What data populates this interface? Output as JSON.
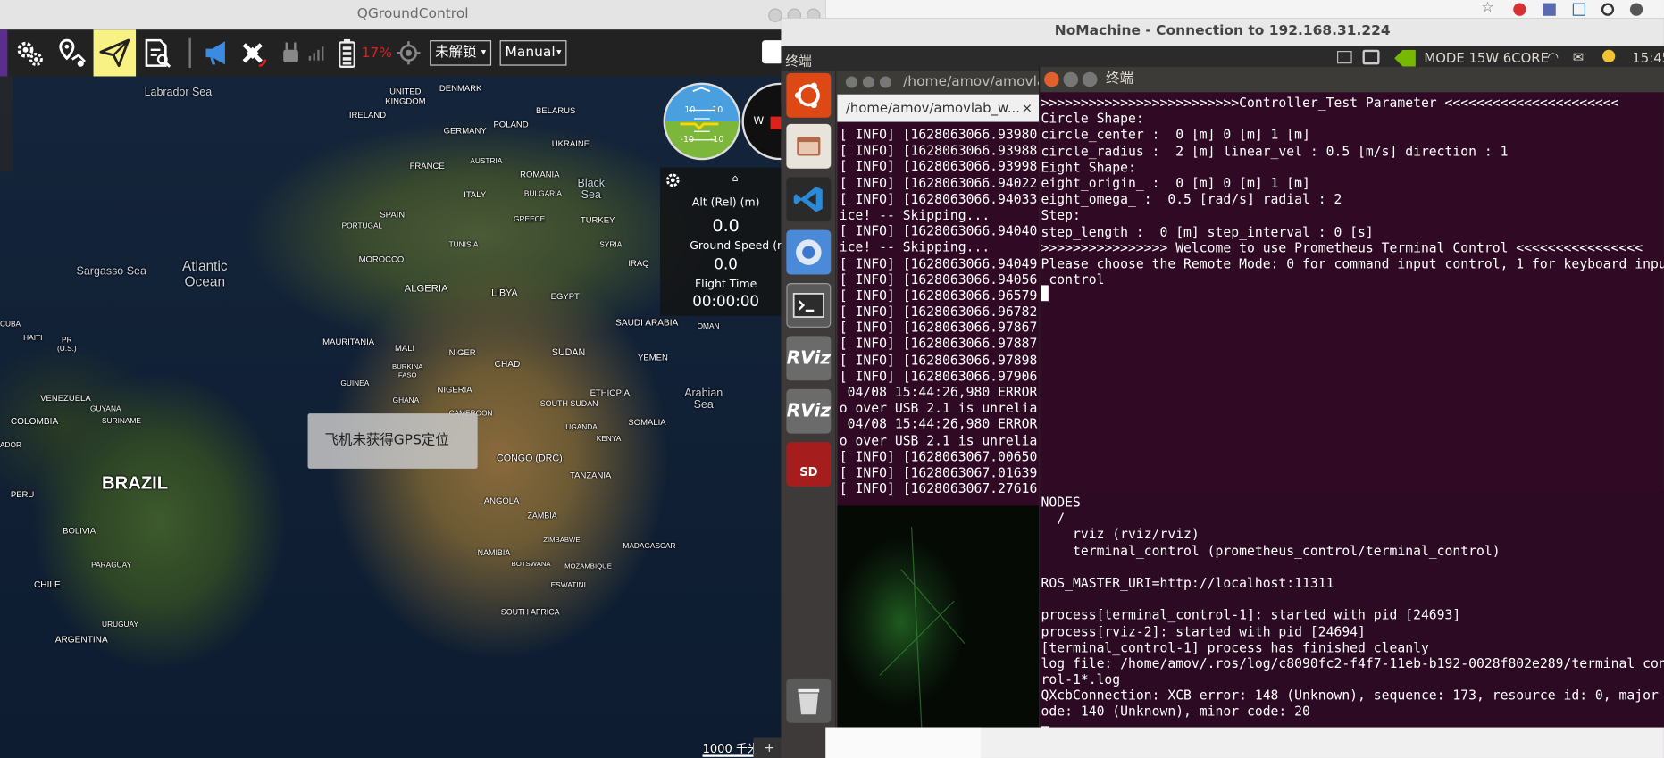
{
  "qgc": {
    "title": "QGroundControl",
    "toolbar": {
      "battery_pct": "17%",
      "arm_label": "未解锁",
      "mode_label": "Manual"
    },
    "map": {
      "labels": {
        "labrador_sea": "Labrador Sea",
        "denmark": "DENMARK",
        "united_kingdom": "UNITED KINGDOM",
        "ireland": "IRELAND",
        "belarus": "BELARUS",
        "poland": "POLAND",
        "germany": "GERMANY",
        "ukraine": "UKRAINE",
        "france": "FRANCE",
        "austria": "AUSTRIA",
        "romania": "ROMANIA",
        "italy": "ITALY",
        "bulgaria": "BULGARIA",
        "black_sea": "Black Sea",
        "spain": "SPAIN",
        "portugal": "PORTUGAL",
        "greece": "GREECE",
        "turkey": "TURKEY",
        "tunisia": "TUNISIA",
        "syria": "SYRIA",
        "iraq": "IRAQ",
        "morocco": "MOROCCO",
        "sargasso_sea": "Sargasso Sea",
        "atlantic_ocean": "Atlantic Ocean",
        "algeria": "ALGERIA",
        "libya": "LIBYA",
        "egypt": "EGYPT",
        "saudi_arabia": "SAUDI ARABIA",
        "oman": "OMAN",
        "cuba": "CUBA",
        "haiti": "HAITI",
        "pr": "PR (U.S.)",
        "mauritania": "MAURITANIA",
        "mali": "MALI",
        "niger": "NIGER",
        "chad": "CHAD",
        "sudan": "SUDAN",
        "yemen": "YEMEN",
        "burkina_faso": "BURKINA FASO",
        "guinea": "GUINEA",
        "nigeria": "NIGERIA",
        "ethiopia": "ETHIOPIA",
        "arabian_sea": "Arabian Sea",
        "venezuela": "VENEZUELA",
        "guyana": "GUYANA",
        "suriname": "SURINAME",
        "ghana": "GHANA",
        "cameroon": "CAMEROON",
        "south_sudan": "SOUTH SUDAN",
        "somalia": "SOMALIA",
        "colombia": "COLOMBIA",
        "uganda": "UGANDA",
        "kenya": "KENYA",
        "ador": "ADOR",
        "congo": "CONGO (DRC)",
        "brazil": "BRAZIL",
        "tanzania": "TANZANIA",
        "peru": "PERU",
        "angola": "ANGOLA",
        "zambia": "ZAMBIA",
        "bolivia": "BOLIVIA",
        "zimbabwe": "ZIMBABWE",
        "madagascar": "MADAGASCAR",
        "paraguay": "PARAGUAY",
        "namibia": "NAMIBIA",
        "botswana": "BOTSWANA",
        "mozambique": "MOZAMBIQUE",
        "chile": "CHILE",
        "eswatini": "ESWATINI",
        "south_africa": "SOUTH AFRICA",
        "uruguay": "URUGUAY",
        "argentina": "ARGENTINA"
      },
      "gps_toast": "飞机未获得GPS定位",
      "scale_label": "1000 千米"
    },
    "attitude": {
      "pitch_top": "10",
      "pitch_bottom": "-10",
      "compass_w": "W"
    },
    "values": {
      "alt_label": "Alt (Rel) (m)",
      "alt_value": "0.0",
      "gs_label": "Ground Speed (m",
      "gs_value": "0.0",
      "ft_label": "Flight Time",
      "ft_value": "00:00:00"
    }
  },
  "nomachine": {
    "title": "NoMachine - Connection to 192.168.31.224",
    "topbar": {
      "app_name": "终端",
      "power_mode": "MODE 15W 6CORE",
      "clock": "15:45"
    },
    "term1": {
      "title": "/home/amov/amovlab",
      "tab_label": "/home/amov/amovlab_w...",
      "lines": [
        "[ INFO] [1628063066.93980",
        "[ INFO] [1628063066.93988",
        "[ INFO] [1628063066.93998",
        "[ INFO] [1628063066.94022",
        "[ INFO] [1628063066.94033",
        "ice! -- Skipping...",
        "[ INFO] [1628063066.94040",
        "ice! -- Skipping...",
        "[ INFO] [1628063066.94049",
        "[ INFO] [1628063066.94056",
        "[ INFO] [1628063066.96579",
        "[ INFO] [1628063066.96782",
        "[ INFO] [1628063066.97867",
        "[ INFO] [1628063066.97887",
        "[ INFO] [1628063066.97898",
        "[ INFO] [1628063066.97906",
        " 04/08 15:44:26,980 ERROR",
        "o over USB 2.1 is unrelia",
        " 04/08 15:44:26,980 ERROR",
        "o over USB 2.1 is unrelia",
        "[ INFO] [1628063067.00650",
        "[ INFO] [1628063067.01639",
        "[ INFO] [1628063067.27616"
      ]
    },
    "term2": {
      "title": "终端",
      "top_lines": [
        ">>>>>>>>>>>>>>>>>>>>>>>>>Controller_Test Parameter <<<<<<<<<<<<<<<<<<<<<<",
        "Circle Shape:",
        "circle_center :  0 [m] 0 [m] 1 [m]",
        "circle_radius :  2 [m] linear_vel : 0.5 [m/s] direction : 1",
        "Eight Shape:",
        "eight_origin_ :  0 [m] 0 [m] 1 [m]",
        "eight_omega_ :  0.5 [rad/s] radial : 2",
        "Step:",
        "step_length :  0 [m] step_interval : 0 [s]",
        ">>>>>>>>>>>>>>>> Welcome to use Prometheus Terminal Control <<<<<<<<<<<<<<<<",
        "Please choose the Remote Mode: 0 for command input control, 1 for keyboard inpu",
        " control"
      ],
      "bottom_lines": [
        "NODES",
        "  /",
        "    rviz (rviz/rviz)",
        "    terminal_control (prometheus_control/terminal_control)",
        "",
        "ROS_MASTER_URI=http://localhost:11311",
        "",
        "process[terminal_control-1]: started with pid [24693]",
        "process[rviz-2]: started with pid [24694]",
        "[terminal_control-1] process has finished cleanly",
        "log file: /home/amov/.ros/log/c8090fc2-f4f7-11eb-b192-0028f802e289/terminal_cont",
        "rol-1*.log",
        "QXcbConnection: XCB error: 148 (Unknown), sequence: 173, resource id: 0, major",
        "ode: 140 (Unknown), minor code: 20"
      ]
    },
    "launcher": {
      "rviz_label": "RViz",
      "sd_label": "SD"
    }
  },
  "colors": {
    "terminal_bg": "#300a24",
    "qgc_toolbar": "#222222",
    "battery_red": "#e0201b",
    "plan_active": "#f8f184"
  }
}
